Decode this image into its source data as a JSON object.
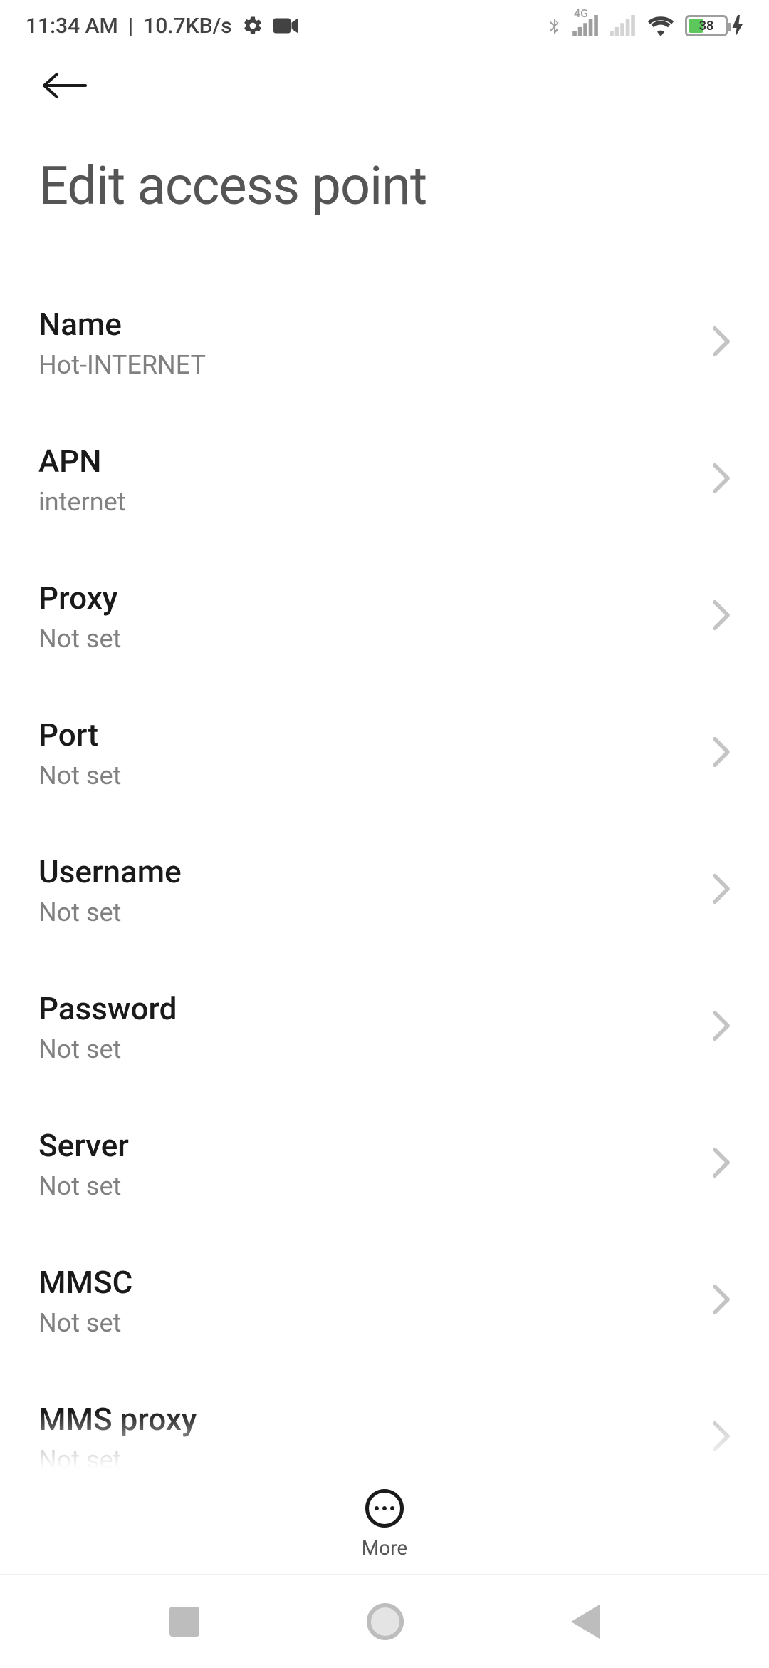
{
  "status": {
    "time": "11:34 AM",
    "separator": "|",
    "speed": "10.7KB/s",
    "network_badge": "4G",
    "battery_pct": "38"
  },
  "page": {
    "title": "Edit access point"
  },
  "items": [
    {
      "label": "Name",
      "value": "Hot-INTERNET"
    },
    {
      "label": "APN",
      "value": "internet"
    },
    {
      "label": "Proxy",
      "value": "Not set"
    },
    {
      "label": "Port",
      "value": "Not set"
    },
    {
      "label": "Username",
      "value": "Not set"
    },
    {
      "label": "Password",
      "value": "Not set"
    },
    {
      "label": "Server",
      "value": "Not set"
    },
    {
      "label": "MMSC",
      "value": "Not set"
    },
    {
      "label": "MMS proxy",
      "value": "Not set"
    }
  ],
  "bottom": {
    "more": "More"
  }
}
